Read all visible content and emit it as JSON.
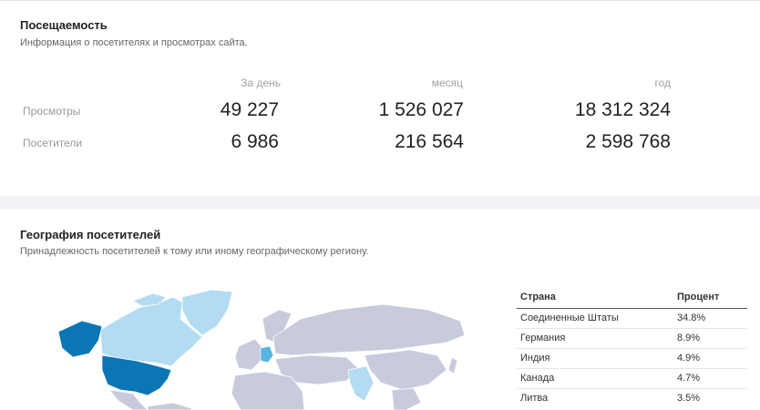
{
  "attendance": {
    "title": "Посещаемость",
    "subtitle": "Информация о посетителях и просмотрах сайта.",
    "columns": [
      "За день",
      "месяц",
      "год"
    ],
    "rows": [
      {
        "label": "Просмотры",
        "values": [
          "49 227",
          "1 526 027",
          "18 312 324"
        ]
      },
      {
        "label": "Посетители",
        "values": [
          "6 986",
          "216 564",
          "2 598 768"
        ]
      }
    ]
  },
  "geography": {
    "title": "География посетителей",
    "subtitle": "Принадлежность посетителей к тому или иному географическому региону.",
    "table": {
      "headers": [
        "Страна",
        "Процент"
      ],
      "rows": [
        {
          "country": "Соединенные Штаты",
          "percent": "34.8%"
        },
        {
          "country": "Германия",
          "percent": "8.9%"
        },
        {
          "country": "Индия",
          "percent": "4.9%"
        },
        {
          "country": "Канада",
          "percent": "4.7%"
        },
        {
          "country": "Литва",
          "percent": "3.5%"
        }
      ]
    },
    "map_colors": {
      "none": "#c8cbdc",
      "low": "#b3dcf2",
      "mid": "#55b4e0",
      "high": "#0b76b5",
      "border": "#ffffff"
    }
  }
}
